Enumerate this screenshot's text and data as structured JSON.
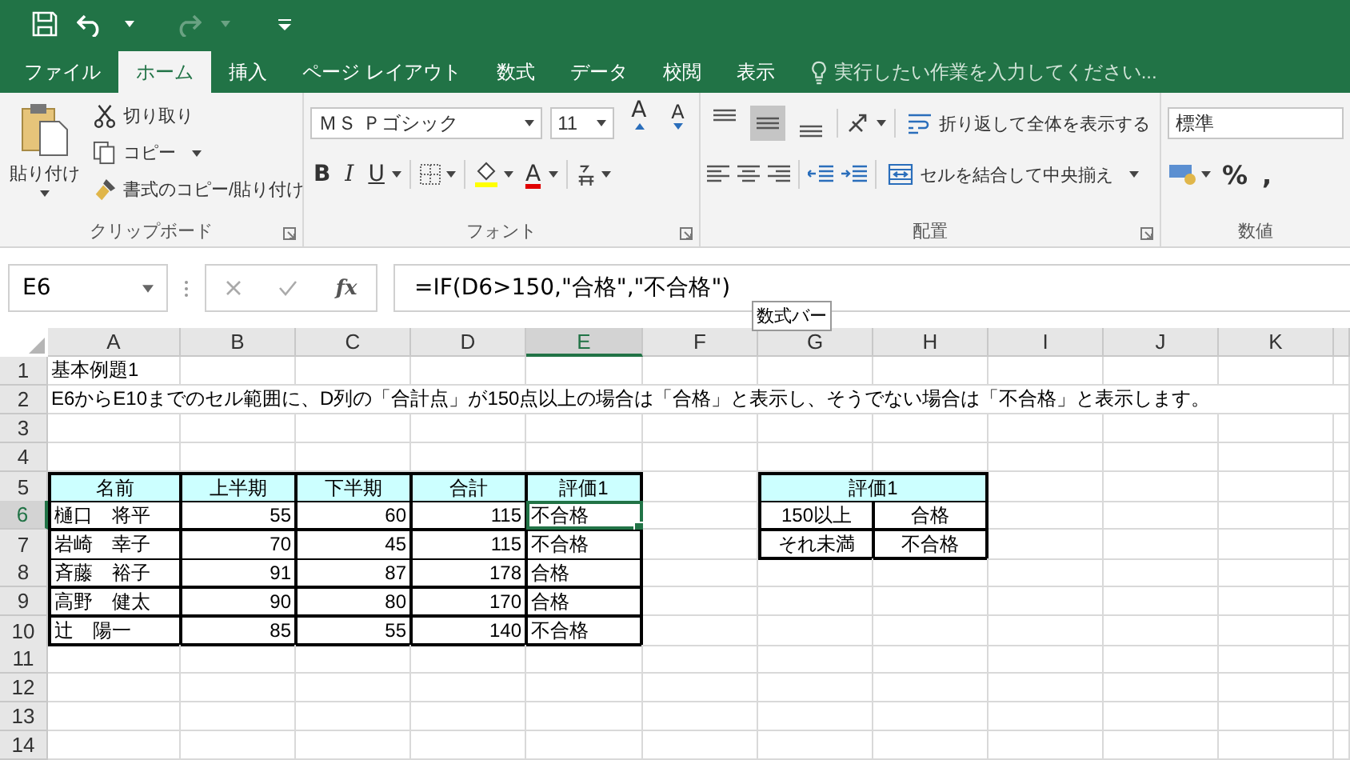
{
  "tabs": [
    {
      "label": "ファイル",
      "selected": false
    },
    {
      "label": "ホーム",
      "selected": true
    },
    {
      "label": "挿入",
      "selected": false
    },
    {
      "label": "ページ レイアウト",
      "selected": false
    },
    {
      "label": "数式",
      "selected": false
    },
    {
      "label": "データ",
      "selected": false
    },
    {
      "label": "校閲",
      "selected": false
    },
    {
      "label": "表示",
      "selected": false
    }
  ],
  "tell_me": {
    "placeholder": "実行したい作業を入力してください..."
  },
  "ribbon": {
    "clipboard": {
      "label": "クリップボード",
      "paste": "貼り付け",
      "cut": "切り取り",
      "copy": "コピー",
      "format_painter": "書式のコピー/貼り付け"
    },
    "font": {
      "label": "フォント",
      "font_name": "ＭＳ Ｐゴシック",
      "font_size": "11",
      "grow": "A",
      "shrink": "A",
      "bold": "B",
      "italic": "I",
      "underline": "U",
      "font_color": "A"
    },
    "alignment": {
      "label": "配置",
      "vertical_align": [
        {
          "selected": false
        },
        {
          "selected": true
        },
        {
          "selected": false
        }
      ],
      "wrap_text": "折り返して全体を表示する",
      "merge": "セルを結合して中央揃え"
    },
    "number": {
      "label": "数値",
      "format": "標準",
      "percent": "%",
      "comma": ","
    }
  },
  "formula_bar": {
    "name_box": "E6",
    "function_label": "fx",
    "formula": "=IF(D6>150,\"合格\",\"不合格\")",
    "tooltip": "数式バー"
  },
  "columns": [
    {
      "letter": "A",
      "selected": false
    },
    {
      "letter": "B",
      "selected": false
    },
    {
      "letter": "C",
      "selected": false
    },
    {
      "letter": "D",
      "selected": false
    },
    {
      "letter": "E",
      "selected": true
    },
    {
      "letter": "F",
      "selected": false
    },
    {
      "letter": "G",
      "selected": false
    },
    {
      "letter": "H",
      "selected": false
    },
    {
      "letter": "I",
      "selected": false
    },
    {
      "letter": "J",
      "selected": false
    },
    {
      "letter": "K",
      "selected": false
    }
  ],
  "rows": [
    {
      "number": "1",
      "selected": false,
      "cells": [
        {
          "kind": "plain",
          "text": "基本例題1"
        },
        {
          "kind": "empty"
        },
        {
          "kind": "empty"
        },
        {
          "kind": "empty"
        },
        {
          "kind": "empty"
        },
        {
          "kind": "empty"
        },
        {
          "kind": "empty"
        },
        {
          "kind": "empty"
        },
        {
          "kind": "empty"
        },
        {
          "kind": "empty"
        },
        {
          "kind": "empty"
        }
      ]
    },
    {
      "number": "2",
      "selected": false,
      "cells": [
        {
          "kind": "plain",
          "text": "E6からE10までのセル範囲に、D列の「合計点」が150点以上の場合は「合格」と表示し、そうでない場合は「不合格」と表示します。"
        },
        {
          "kind": "empty"
        },
        {
          "kind": "empty"
        },
        {
          "kind": "empty"
        },
        {
          "kind": "empty"
        },
        {
          "kind": "empty"
        },
        {
          "kind": "empty"
        },
        {
          "kind": "empty"
        },
        {
          "kind": "empty"
        },
        {
          "kind": "empty"
        },
        {
          "kind": "empty"
        }
      ]
    },
    {
      "number": "3",
      "selected": false,
      "cells": [
        {
          "kind": "empty"
        },
        {
          "kind": "empty"
        },
        {
          "kind": "empty"
        },
        {
          "kind": "empty"
        },
        {
          "kind": "empty"
        },
        {
          "kind": "empty"
        },
        {
          "kind": "empty"
        },
        {
          "kind": "empty"
        },
        {
          "kind": "empty"
        },
        {
          "kind": "empty"
        },
        {
          "kind": "empty"
        }
      ]
    },
    {
      "number": "4",
      "selected": false,
      "cells": [
        {
          "kind": "empty"
        },
        {
          "kind": "empty"
        },
        {
          "kind": "empty"
        },
        {
          "kind": "empty"
        },
        {
          "kind": "empty"
        },
        {
          "kind": "empty"
        },
        {
          "kind": "empty"
        },
        {
          "kind": "empty"
        },
        {
          "kind": "empty"
        },
        {
          "kind": "empty"
        },
        {
          "kind": "empty"
        }
      ]
    },
    {
      "number": "5",
      "selected": false,
      "cells": [
        {
          "kind": "header",
          "text": "名前"
        },
        {
          "kind": "header",
          "text": "上半期"
        },
        {
          "kind": "header",
          "text": "下半期"
        },
        {
          "kind": "header",
          "text": "合計"
        },
        {
          "kind": "header",
          "text": "評価1"
        },
        {
          "kind": "empty"
        },
        {
          "kind": "header",
          "text": "評価1"
        },
        {
          "kind": "merged"
        },
        {
          "kind": "empty"
        },
        {
          "kind": "empty"
        },
        {
          "kind": "empty"
        }
      ]
    },
    {
      "number": "6",
      "selected": true,
      "cells": [
        {
          "kind": "text",
          "text": "樋口　将平"
        },
        {
          "kind": "number",
          "text": "55"
        },
        {
          "kind": "number",
          "text": "60"
        },
        {
          "kind": "number",
          "text": "115"
        },
        {
          "kind": "text",
          "text": "不合格"
        },
        {
          "kind": "empty"
        },
        {
          "kind": "center",
          "text": "150以上"
        },
        {
          "kind": "center",
          "text": "合格"
        },
        {
          "kind": "empty"
        },
        {
          "kind": "empty"
        },
        {
          "kind": "empty"
        }
      ]
    },
    {
      "number": "7",
      "selected": false,
      "cells": [
        {
          "kind": "text",
          "text": "岩崎　幸子"
        },
        {
          "kind": "number",
          "text": "70"
        },
        {
          "kind": "number",
          "text": "45"
        },
        {
          "kind": "number",
          "text": "115"
        },
        {
          "kind": "text",
          "text": "不合格"
        },
        {
          "kind": "empty"
        },
        {
          "kind": "center",
          "text": "それ未満"
        },
        {
          "kind": "center",
          "text": "不合格"
        },
        {
          "kind": "empty"
        },
        {
          "kind": "empty"
        },
        {
          "kind": "empty"
        }
      ]
    },
    {
      "number": "8",
      "selected": false,
      "cells": [
        {
          "kind": "text",
          "text": "斉藤　裕子"
        },
        {
          "kind": "number",
          "text": "91"
        },
        {
          "kind": "number",
          "text": "87"
        },
        {
          "kind": "number",
          "text": "178"
        },
        {
          "kind": "text",
          "text": "合格"
        },
        {
          "kind": "empty"
        },
        {
          "kind": "empty"
        },
        {
          "kind": "empty"
        },
        {
          "kind": "empty"
        },
        {
          "kind": "empty"
        },
        {
          "kind": "empty"
        }
      ]
    },
    {
      "number": "9",
      "selected": false,
      "cells": [
        {
          "kind": "text",
          "text": "高野　健太"
        },
        {
          "kind": "number",
          "text": "90"
        },
        {
          "kind": "number",
          "text": "80"
        },
        {
          "kind": "number",
          "text": "170"
        },
        {
          "kind": "text",
          "text": "合格"
        },
        {
          "kind": "empty"
        },
        {
          "kind": "empty"
        },
        {
          "kind": "empty"
        },
        {
          "kind": "empty"
        },
        {
          "kind": "empty"
        },
        {
          "kind": "empty"
        }
      ]
    },
    {
      "number": "10",
      "selected": false,
      "cells": [
        {
          "kind": "text",
          "text": "辻　陽一"
        },
        {
          "kind": "number",
          "text": "85"
        },
        {
          "kind": "number",
          "text": "55"
        },
        {
          "kind": "number",
          "text": "140"
        },
        {
          "kind": "text",
          "text": "不合格"
        },
        {
          "kind": "empty"
        },
        {
          "kind": "empty"
        },
        {
          "kind": "empty"
        },
        {
          "kind": "empty"
        },
        {
          "kind": "empty"
        },
        {
          "kind": "empty"
        }
      ]
    },
    {
      "number": "11",
      "selected": false,
      "cells": [
        {
          "kind": "empty"
        },
        {
          "kind": "empty"
        },
        {
          "kind": "empty"
        },
        {
          "kind": "empty"
        },
        {
          "kind": "empty"
        },
        {
          "kind": "empty"
        },
        {
          "kind": "empty"
        },
        {
          "kind": "empty"
        },
        {
          "kind": "empty"
        },
        {
          "kind": "empty"
        },
        {
          "kind": "empty"
        }
      ]
    },
    {
      "number": "12",
      "selected": false,
      "cells": [
        {
          "kind": "empty"
        },
        {
          "kind": "empty"
        },
        {
          "kind": "empty"
        },
        {
          "kind": "empty"
        },
        {
          "kind": "empty"
        },
        {
          "kind": "empty"
        },
        {
          "kind": "empty"
        },
        {
          "kind": "empty"
        },
        {
          "kind": "empty"
        },
        {
          "kind": "empty"
        },
        {
          "kind": "empty"
        }
      ]
    },
    {
      "number": "13",
      "selected": false,
      "cells": [
        {
          "kind": "empty"
        },
        {
          "kind": "empty"
        },
        {
          "kind": "empty"
        },
        {
          "kind": "empty"
        },
        {
          "kind": "empty"
        },
        {
          "kind": "empty"
        },
        {
          "kind": "empty"
        },
        {
          "kind": "empty"
        },
        {
          "kind": "empty"
        },
        {
          "kind": "empty"
        },
        {
          "kind": "empty"
        }
      ]
    },
    {
      "number": "14",
      "selected": false,
      "cells": [
        {
          "kind": "empty"
        },
        {
          "kind": "empty"
        },
        {
          "kind": "empty"
        },
        {
          "kind": "empty"
        },
        {
          "kind": "empty"
        },
        {
          "kind": "empty"
        },
        {
          "kind": "empty"
        },
        {
          "kind": "empty"
        },
        {
          "kind": "empty"
        },
        {
          "kind": "empty"
        },
        {
          "kind": "empty"
        }
      ]
    }
  ]
}
